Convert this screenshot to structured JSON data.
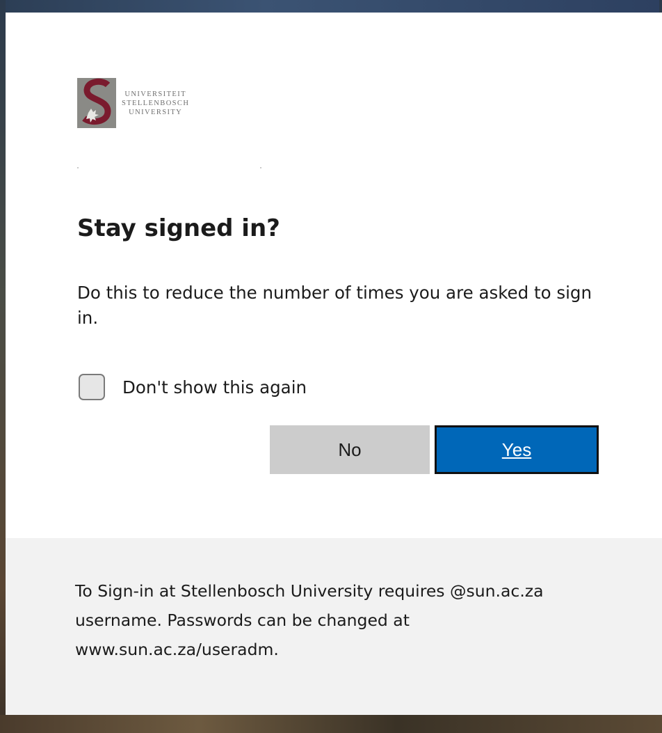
{
  "logo": {
    "line1": "UNIVERSITEIT",
    "line2": "STELLENBOSCH",
    "line3": "UNIVERSITY",
    "colors": {
      "mark_gray": "#8a8a86",
      "mark_red": "#7a1b2e"
    }
  },
  "dialog": {
    "title": "Stay signed in?",
    "description": "Do this to reduce the number of times you are asked to sign in.",
    "checkbox": {
      "label": "Don't show this again",
      "checked": false
    },
    "no_label": "No",
    "yes_label": "Yes"
  },
  "footer": {
    "text": "To Sign-in at Stellenbosch University requires @sun.ac.za username. Passwords can be changed at www.sun.ac.za/useradm."
  },
  "colors": {
    "primary": "#0067b8",
    "secondary_button": "#cccccc",
    "footer_bg": "#f2f2f2"
  }
}
